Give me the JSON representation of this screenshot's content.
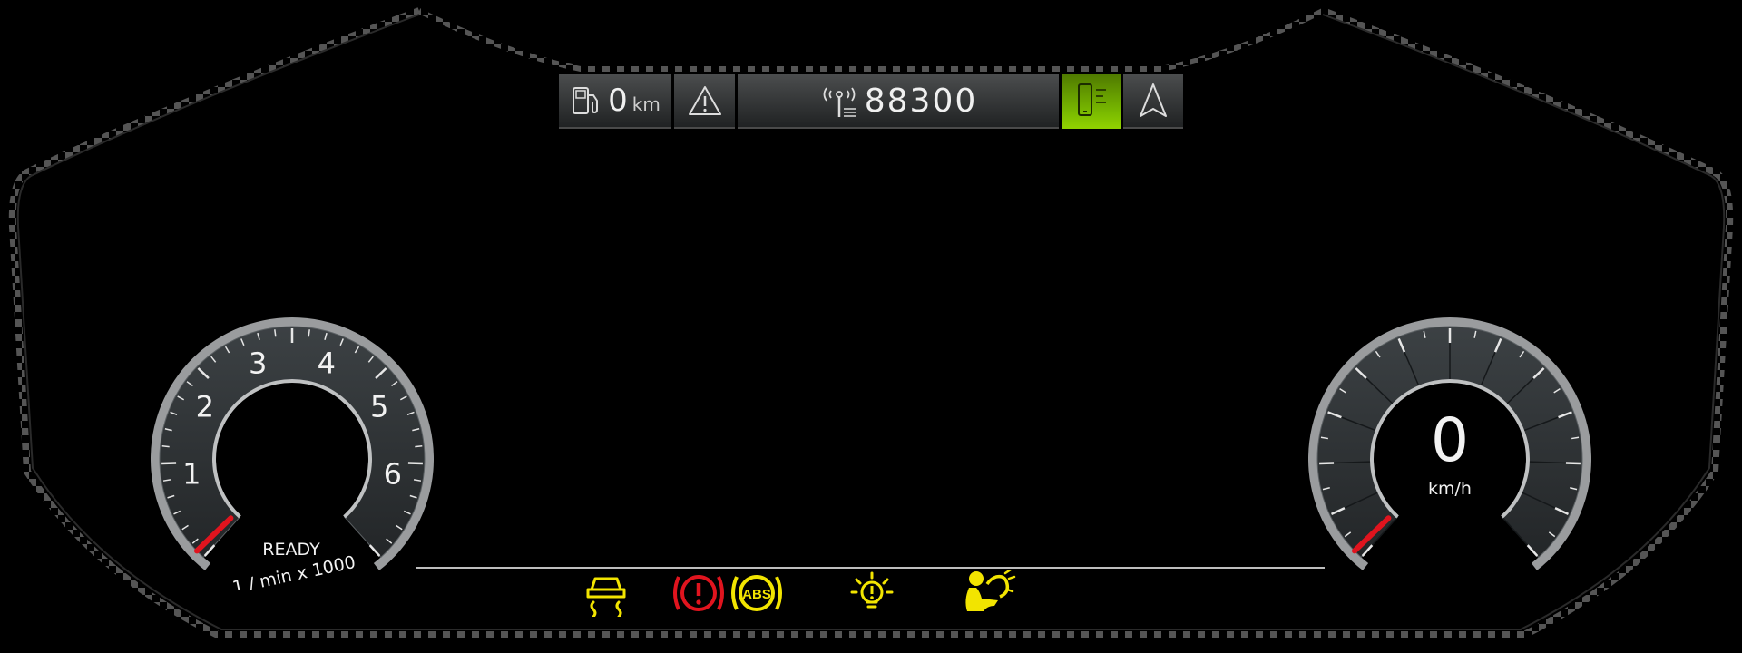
{
  "top_bar": {
    "range_value": "0",
    "range_unit": "km",
    "radio_frequency": "88300",
    "icons": [
      "fuel-pump-icon",
      "warning-triangle-icon",
      "radio-antenna-icon",
      "phone-icon",
      "navigation-arrow-icon"
    ],
    "phone_active_color": "#8fd000"
  },
  "tachometer": {
    "tick_labels": [
      "1",
      "2",
      "3",
      "4",
      "5",
      "6"
    ],
    "status": "READY",
    "unit": "1 / min x 1000",
    "needle_color": "#e0141e",
    "value": 0
  },
  "speedometer": {
    "speed": "0",
    "unit": "km/h",
    "needle_color": "#e0141e"
  },
  "warning_lamps": [
    {
      "icon": "traction-control-icon",
      "color": "#f2e400"
    },
    {
      "icon": "brake-warning-icon",
      "color": "#e0141e"
    },
    {
      "icon": "abs-icon",
      "color": "#f2e400",
      "label": "ABS"
    },
    {
      "icon": "bulb-failure-icon",
      "color": "#f2e400"
    },
    {
      "icon": "airbag-warning-icon",
      "color": "#f2e400"
    }
  ]
}
